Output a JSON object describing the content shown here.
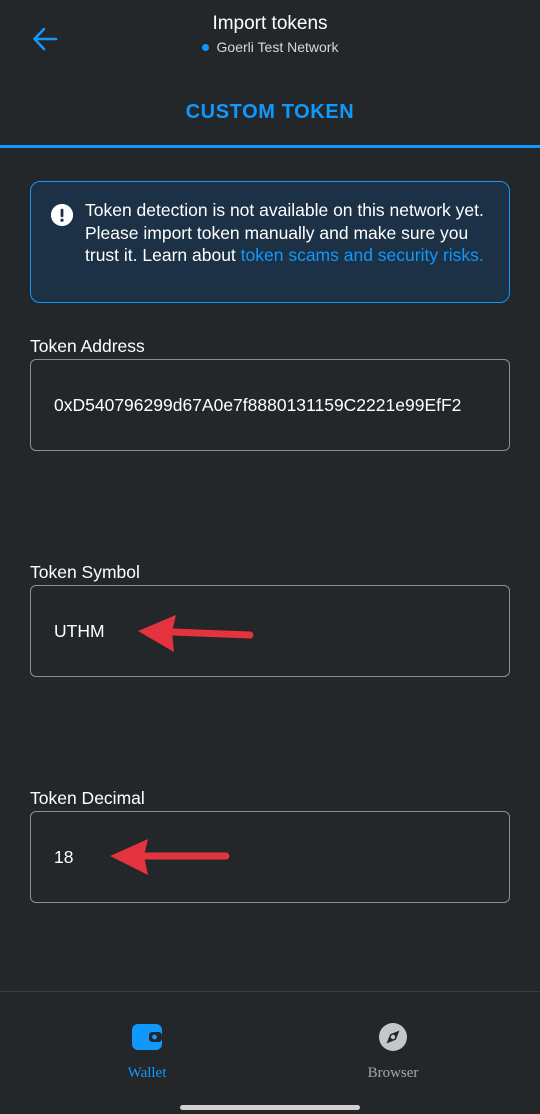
{
  "header": {
    "title": "Import tokens",
    "network": "Goerli Test Network",
    "back_icon": "arrow-left-icon"
  },
  "tab": {
    "label": "CUSTOM TOKEN"
  },
  "alert": {
    "text": "Token detection is not available on this network yet. Please import token manually and make sure you trust it. Learn about ",
    "link": "token scams and security risks.",
    "icon": "info-exclamation-icon"
  },
  "fields": {
    "address": {
      "label": "Token Address",
      "value": "0xD540796299d67A0e7f8880131159C2221e99EfF2"
    },
    "symbol": {
      "label": "Token Symbol",
      "value": "UTHM"
    },
    "decimal": {
      "label": "Token Decimal",
      "value": "18"
    }
  },
  "tabbar": {
    "wallet": "Wallet",
    "browser": "Browser"
  },
  "colors": {
    "accent": "#1098fc",
    "background": "#24272a",
    "annotation_arrow": "#e2333f"
  }
}
